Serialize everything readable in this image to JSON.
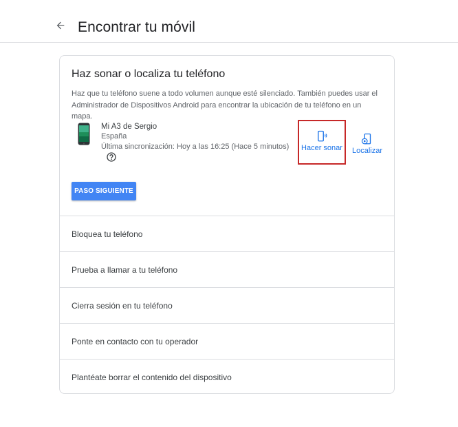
{
  "header": {
    "title": "Encontrar tu móvil",
    "back_icon": "arrow-back-icon"
  },
  "card": {
    "title": "Haz sonar o localiza tu teléfono",
    "description": "Haz que tu teléfono suene a todo volumen aunque esté silenciado. También puedes usar el Administrador de Dispositivos Android para encontrar la ubicación de tu teléfono en un mapa.",
    "device": {
      "name": "Mi A3 de Sergio",
      "country": "España",
      "sync": "Última sincronización: Hoy a las 16:25 (Hace 5 minutos)",
      "help_icon": "help-circle-icon"
    },
    "actions": {
      "ring_label": "Hacer sonar",
      "locate_label": "Localizar"
    },
    "next_button": "PASO SIGUIENTE"
  },
  "rows": [
    {
      "label": "Bloquea tu teléfono"
    },
    {
      "label": "Prueba a llamar a tu teléfono"
    },
    {
      "label": "Cierra sesión en tu teléfono"
    },
    {
      "label": "Ponte en contacto con tu operador"
    },
    {
      "label": "Plantéate borrar el contenido del dispositivo"
    }
  ],
  "colors": {
    "accent": "#1a73e8",
    "button": "#4285f4",
    "highlight": "#c62828"
  }
}
